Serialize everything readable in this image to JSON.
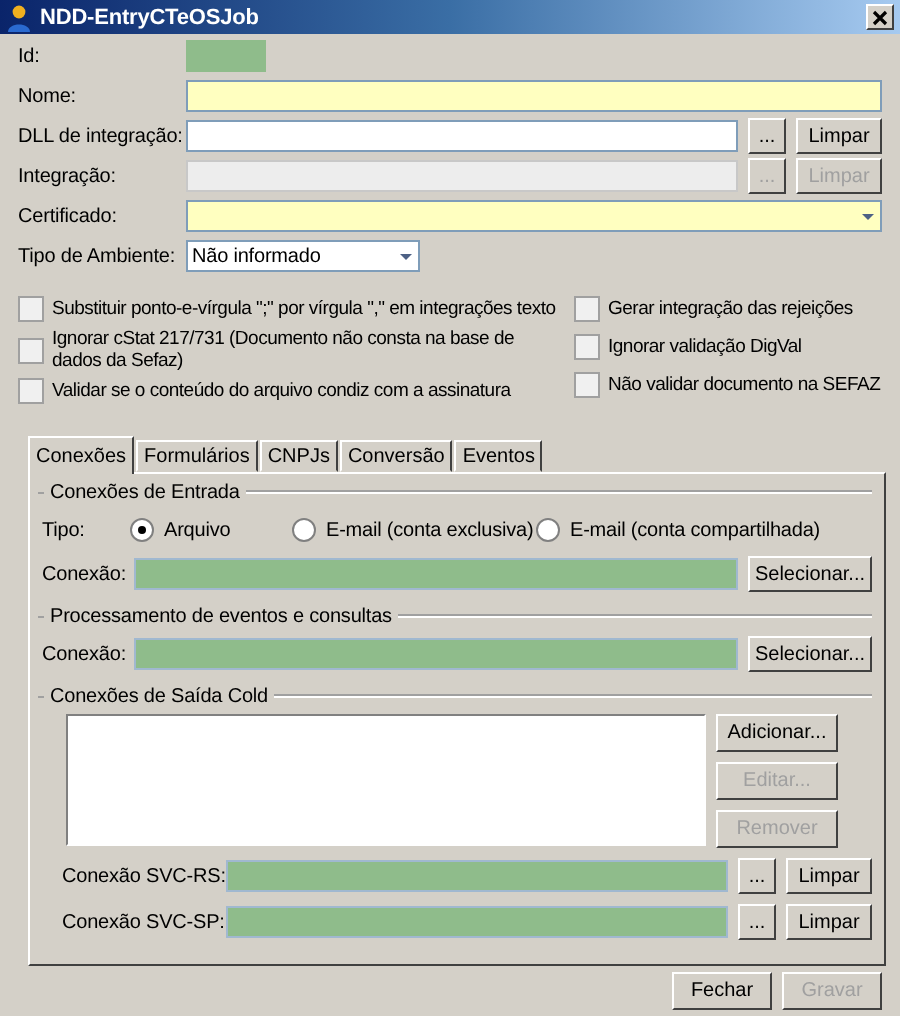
{
  "window": {
    "title": "NDD-EntryCTeOSJob"
  },
  "fields": [
    {
      "label": "Id:",
      "kind": "readonly"
    },
    {
      "label": "Nome:",
      "kind": "text",
      "required": true
    },
    {
      "label": "DLL de integração:",
      "kind": "browse",
      "required": false,
      "disabled": false,
      "buttons": [
        "...",
        "Limpar"
      ]
    },
    {
      "label": "Integração:",
      "kind": "browse",
      "required": false,
      "disabled": true,
      "buttons": [
        "...",
        "Limpar"
      ]
    },
    {
      "label": "Certificado:",
      "kind": "combo",
      "required": true
    },
    {
      "label": "Tipo de Ambiente:",
      "kind": "short-combo",
      "required": false,
      "value": "Não informado"
    }
  ],
  "options_left": [
    {
      "label": "Substituir ponto-e-vírgula \";\" por vírgula \",\" em integrações texto",
      "checked": false
    },
    {
      "label": "Ignorar cStat 217/731 (Documento não consta na base de dados da Sefaz)",
      "checked": false
    },
    {
      "label": "Validar se o conteúdo do arquivo condiz com a assinatura",
      "checked": false
    }
  ],
  "options_right": [
    {
      "label": "Gerar integração das rejeições",
      "checked": false
    },
    {
      "label": "Ignorar validação DigVal",
      "checked": false
    },
    {
      "label": "Não validar documento na SEFAZ",
      "checked": false
    }
  ],
  "tabs": [
    {
      "label": "Conexões",
      "selected": true
    },
    {
      "label": "Formulários",
      "selected": false
    },
    {
      "label": "CNPJs",
      "selected": false
    },
    {
      "label": "Conversão",
      "selected": false
    },
    {
      "label": "Eventos",
      "selected": false
    }
  ],
  "entrada": {
    "title": "Conexões de Entrada",
    "tipo_label": "Tipo:",
    "radios": [
      {
        "label": "Arquivo",
        "selected": true
      },
      {
        "label": "E-mail (conta exclusiva)",
        "selected": false
      },
      {
        "label": "E-mail (conta compartilhada)",
        "selected": false
      }
    ],
    "conexao_label": "Conexão:",
    "button": "Selecionar..."
  },
  "processamento": {
    "title": "Processamento de eventos e consultas",
    "conexao_label": "Conexão:",
    "button": "Selecionar..."
  },
  "saida": {
    "title": "Conexões de Saída Cold",
    "buttons": [
      {
        "label": "Adicionar...",
        "disabled": false
      },
      {
        "label": "Editar...",
        "disabled": true
      },
      {
        "label": "Remover",
        "disabled": true
      }
    ],
    "svc": [
      {
        "label": "Conexão SVC-RS:",
        "buttons": [
          "...",
          "Limpar"
        ]
      },
      {
        "label": "Conexão SVC-SP:",
        "buttons": [
          "...",
          "Limpar"
        ]
      }
    ]
  },
  "footer": [
    {
      "label": "Fechar",
      "disabled": false
    },
    {
      "label": "Gravar",
      "disabled": true
    }
  ]
}
